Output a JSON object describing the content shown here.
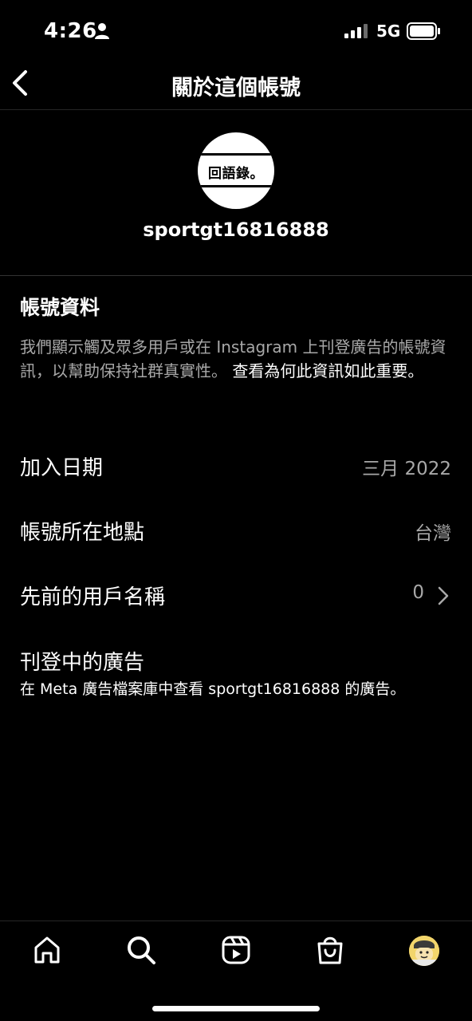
{
  "status": {
    "time": "4:26",
    "network": "5G"
  },
  "header": {
    "title": "關於這個帳號"
  },
  "profile": {
    "avatar_text": "回語錄。",
    "username": "sportgt16816888"
  },
  "account_info": {
    "title": "帳號資料",
    "description": "我們顯示觸及眾多用戶或在 Instagram 上刊登廣告的帳號資訊，以幫助保持社群真實性。",
    "learn_more": "查看為何此資訊如此重要。"
  },
  "rows": {
    "join_date": {
      "label": "加入日期",
      "value": "三月 2022"
    },
    "location": {
      "label": "帳號所在地點",
      "value": "台灣"
    },
    "former_usernames": {
      "label": "先前的用戶名稱",
      "value": "0"
    }
  },
  "ads": {
    "title": "刊登中的廣告",
    "link": "在 Meta 廣告檔案庫中查看 sportgt16816888 的廣告。"
  },
  "tab_bar": {
    "icons": [
      "home-icon",
      "search-icon",
      "reels-icon",
      "shop-icon",
      "profile-avatar"
    ]
  },
  "colors": {
    "background": "#000000",
    "text_primary": "#ffffff",
    "text_secondary": "#a8a8a8",
    "divider": "#262626"
  }
}
